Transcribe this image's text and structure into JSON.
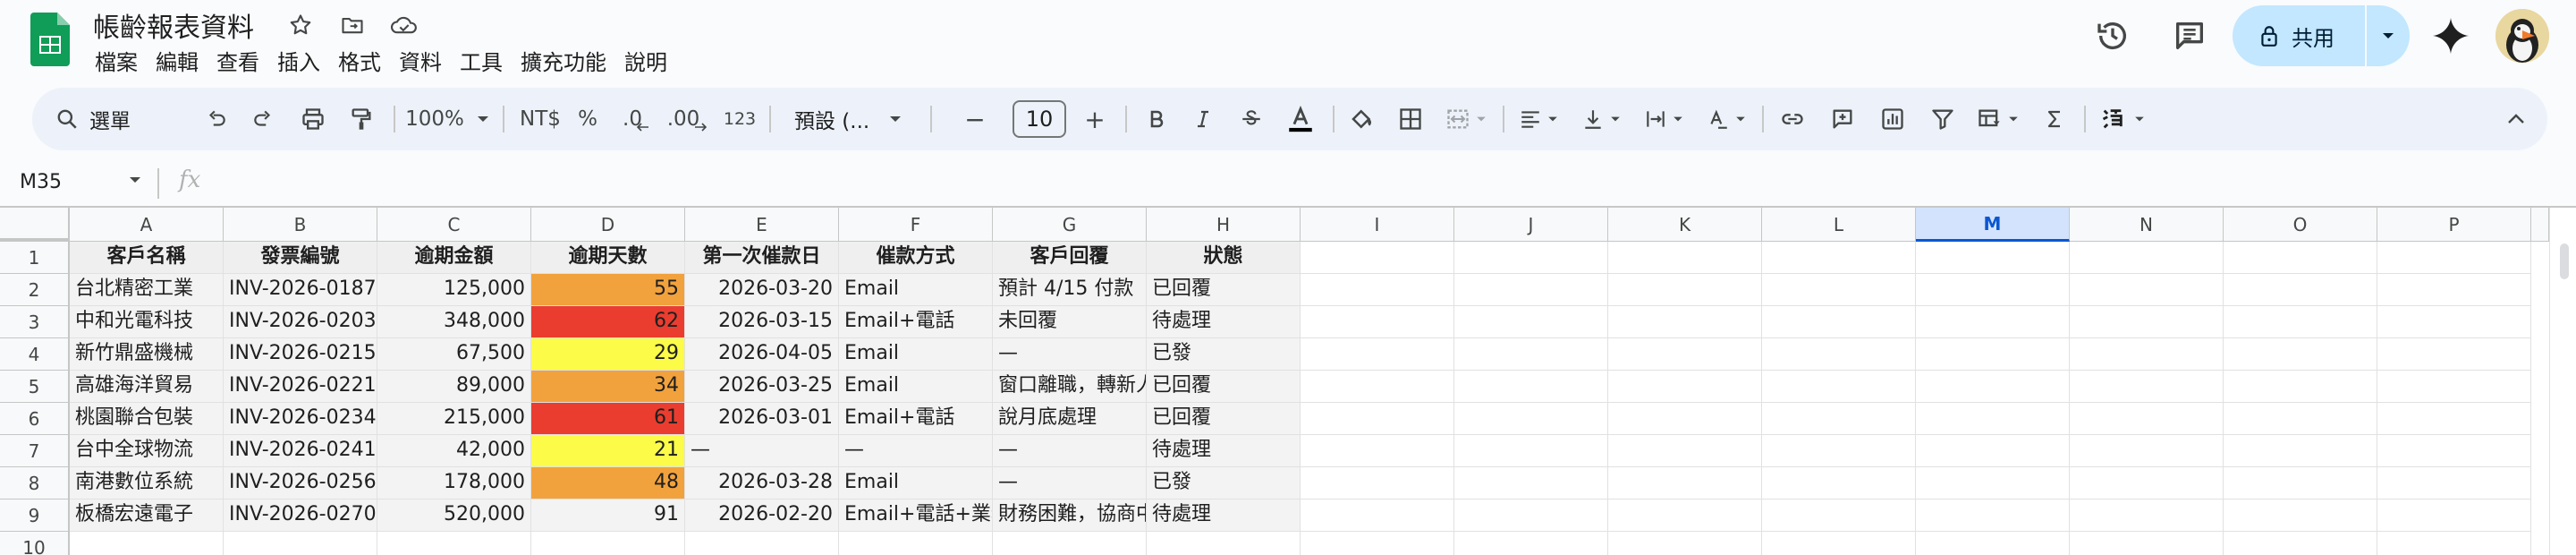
{
  "app": {
    "doc_title": "帳齡報表資料",
    "menu": [
      "檔案",
      "編輯",
      "查看",
      "插入",
      "格式",
      "資料",
      "工具",
      "擴充功能",
      "說明"
    ],
    "share_label": "共用"
  },
  "toolbar": {
    "search_label": "選單",
    "zoom": "100%",
    "currency": "NT$",
    "percent": "%",
    "dec_decrease": ".0",
    "dec_increase": ".00",
    "number_format": "123",
    "font": "預設 (...",
    "font_size": "10",
    "minus": "−",
    "plus": "+"
  },
  "formula_bar": {
    "cell_ref": "M35",
    "fx": "fx"
  },
  "sheet": {
    "columns": [
      "A",
      "B",
      "C",
      "D",
      "E",
      "F",
      "G",
      "H",
      "I",
      "J",
      "K",
      "L",
      "M",
      "N",
      "O",
      "P"
    ],
    "selected_column": "M",
    "row_numbers": [
      "1",
      "2",
      "3",
      "4",
      "5",
      "6",
      "7",
      "8",
      "9",
      "10"
    ],
    "header": [
      "客戶名稱",
      "發票編號",
      "逾期金額",
      "逾期天數",
      "第一次催款日",
      "催款方式",
      "客戶回覆",
      "狀態"
    ],
    "rows": [
      {
        "name": "台北精密工業",
        "invoice": "INV-2026-0187",
        "amount": "125,000",
        "days": "55",
        "first_date": "2026-03-20",
        "method": "Email",
        "reply": "預計 4/15 付款",
        "status": "已回覆",
        "days_color": "#f2a23c"
      },
      {
        "name": "中和光電科技",
        "invoice": "INV-2026-0203",
        "amount": "348,000",
        "days": "62",
        "first_date": "2026-03-15",
        "method": "Email+電話",
        "reply": "未回覆",
        "status": "待處理",
        "days_color": "#ea3d2f"
      },
      {
        "name": "新竹鼎盛機械",
        "invoice": "INV-2026-0215",
        "amount": "67,500",
        "days": "29",
        "first_date": "2026-04-05",
        "method": "Email",
        "reply": "—",
        "status": "已發",
        "days_color": "#fbfb48"
      },
      {
        "name": "高雄海洋貿易",
        "invoice": "INV-2026-0221",
        "amount": "89,000",
        "days": "34",
        "first_date": "2026-03-25",
        "method": "Email",
        "reply": "窗口離職，轉新人",
        "status": "已回覆",
        "days_color": "#f2a23c"
      },
      {
        "name": "桃園聯合包裝",
        "invoice": "INV-2026-0234",
        "amount": "215,000",
        "days": "61",
        "first_date": "2026-03-01",
        "method": "Email+電話",
        "reply": "說月底處理",
        "status": "已回覆",
        "days_color": "#ea3d2f"
      },
      {
        "name": "台中全球物流",
        "invoice": "INV-2026-0241",
        "amount": "42,000",
        "days": "21",
        "first_date": "—",
        "method": "—",
        "reply": "—",
        "status": "待處理",
        "days_color": "#fbfb48"
      },
      {
        "name": "南港數位系統",
        "invoice": "INV-2026-0256",
        "amount": "178,000",
        "days": "48",
        "first_date": "2026-03-28",
        "method": "Email",
        "reply": "—",
        "status": "已發",
        "days_color": "#f2a23c"
      },
      {
        "name": "板橋宏遠電子",
        "invoice": "INV-2026-0270",
        "amount": "520,000",
        "days": "91",
        "first_date": "2026-02-20",
        "method": "Email+電話+業務",
        "reply": "財務困難，協商中",
        "status": "待處理",
        "days_color": "#f3f3f3"
      }
    ]
  },
  "colors": {
    "accent": "#0b57d0",
    "share_bg": "#c2e7ff",
    "toolbar_bg": "#edf2fa"
  }
}
